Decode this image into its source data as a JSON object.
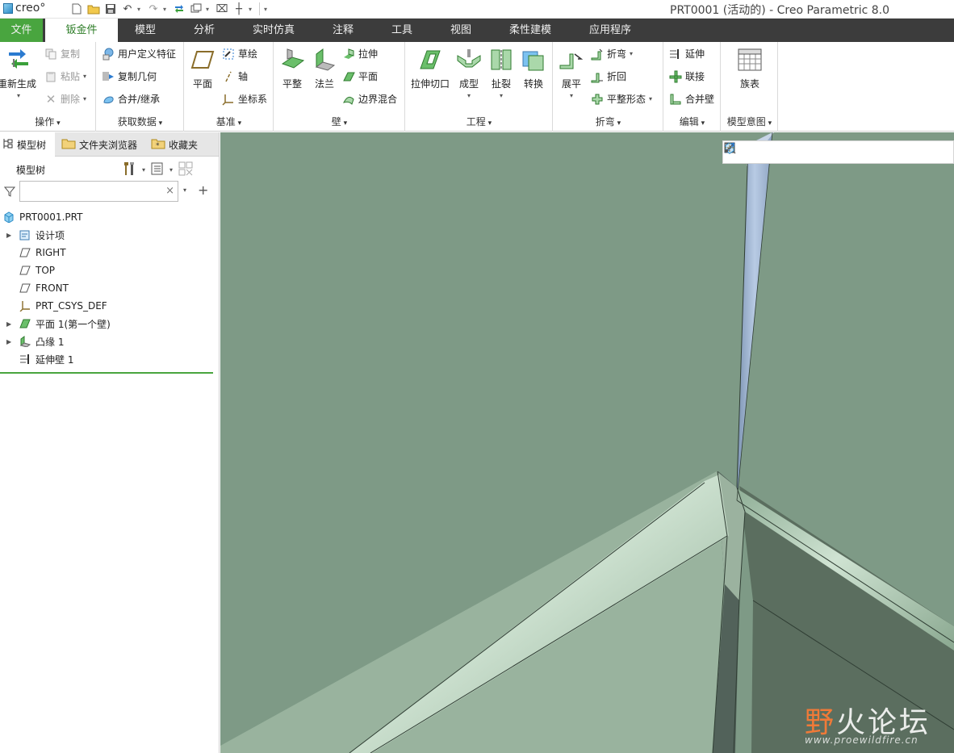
{
  "window": {
    "logo_text": "creo°",
    "title": "PRT0001 (活动的) - Creo Parametric 8.0"
  },
  "ribbon_tabs": [
    "文件",
    "钣金件",
    "模型",
    "分析",
    "实时仿真",
    "注释",
    "工具",
    "视图",
    "柔性建模",
    "应用程序"
  ],
  "groups": {
    "operations": {
      "label": "操作",
      "regenerate": "重新生成",
      "copy": "复制",
      "paste": "粘贴",
      "delete": "删除"
    },
    "get_data": {
      "label": "获取数据",
      "udf": "用户定义特征",
      "copy_geom": "复制几何",
      "merge_inherit": "合并/继承"
    },
    "datum": {
      "label": "基准",
      "plane": "平面",
      "sketch": "草绘",
      "axis": "轴",
      "csys": "坐标系"
    },
    "wall": {
      "label": "壁",
      "flat": "平整",
      "flange": "法兰",
      "extrude": "拉伸",
      "planar": "平面",
      "boundary_blend": "边界混合"
    },
    "engineering": {
      "label": "工程",
      "extrude_cut": "拉伸切口",
      "form": "成型",
      "rip": "扯裂",
      "convert": "转换"
    },
    "bend": {
      "label": "折弯",
      "unbend": "展平",
      "bend": "折弯",
      "bend_back": "折回",
      "flat_pattern": "平整形态"
    },
    "edit": {
      "label": "编辑",
      "extend": "延伸",
      "join": "联接",
      "merge_walls": "合并壁"
    },
    "intent": {
      "label": "模型意图",
      "family_table": "族表"
    }
  },
  "panel": {
    "tabs": [
      "模型树",
      "文件夹浏览器",
      "收藏夹"
    ],
    "tree_title": "模型树",
    "search_placeholder": ""
  },
  "tree": [
    {
      "label": "PRT0001.PRT",
      "icon": "part-icon",
      "expandable": false
    },
    {
      "label": "设计项",
      "icon": "design-items-icon",
      "expandable": true
    },
    {
      "label": "RIGHT",
      "icon": "datum-plane-icon",
      "expandable": false
    },
    {
      "label": "TOP",
      "icon": "datum-plane-icon",
      "expandable": false
    },
    {
      "label": "FRONT",
      "icon": "datum-plane-icon",
      "expandable": false
    },
    {
      "label": "PRT_CSYS_DEF",
      "icon": "csys-icon",
      "expandable": false
    },
    {
      "label": "平面 1(第一个壁)",
      "icon": "planar-wall-icon",
      "expandable": true
    },
    {
      "label": "凸缘 1",
      "icon": "flange-icon",
      "expandable": true
    },
    {
      "label": "延伸壁 1",
      "icon": "extend-wall-icon",
      "expandable": false
    }
  ],
  "watermark": {
    "ye": "野",
    "rest": "火论坛",
    "url": "www.proewildfire.cn"
  },
  "colors": {
    "accent": "#49a53f",
    "tabbar": "#3c3c3c",
    "viewport_bg": "#7e9a86"
  }
}
